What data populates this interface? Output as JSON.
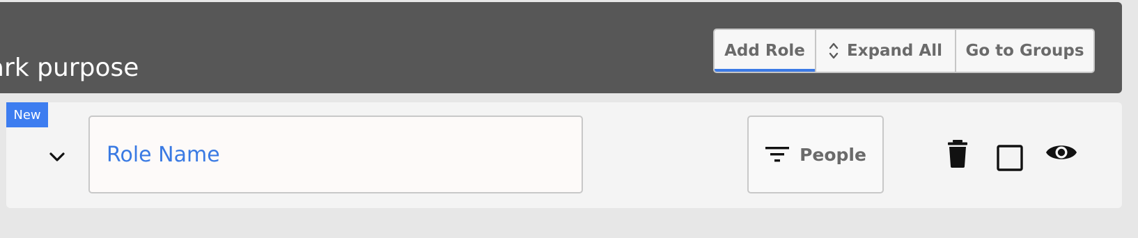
{
  "header": {
    "title": "ark purpose",
    "background_color": "#575757",
    "buttons": {
      "add_role": "Add Role",
      "expand_all": "Expand All",
      "go_to_groups": "Go to Groups"
    },
    "active_button": "Add Role",
    "accent_color": "#3c7ae6"
  },
  "role": {
    "badge": "New",
    "badge_color": "#3d7df0",
    "name_placeholder": "Role Name",
    "name_value": "",
    "filter_button_label": "People",
    "icons": {
      "collapse": "chevron-down-icon",
      "expand_all": "unfold-icon",
      "filter": "filter-list-icon",
      "delete": "trash-icon",
      "select": "checkbox-icon",
      "preview": "eye-icon"
    }
  }
}
